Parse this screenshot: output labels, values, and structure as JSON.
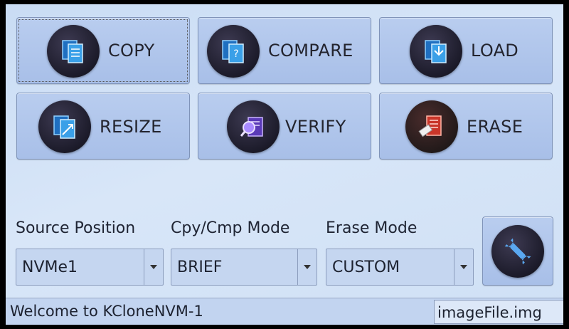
{
  "buttons": {
    "copy": {
      "label": "COPY",
      "icon": "copy-document-icon"
    },
    "compare": {
      "label": "COMPARE",
      "icon": "compare-document-icon"
    },
    "load": {
      "label": "LOAD",
      "icon": "load-document-icon"
    },
    "resize": {
      "label": "RESIZE",
      "icon": "resize-document-icon"
    },
    "verify": {
      "label": "VERIFY",
      "icon": "magnifier-document-icon"
    },
    "erase": {
      "label": "ERASE",
      "icon": "eraser-document-icon"
    }
  },
  "settings": {
    "source_position": {
      "label": "Source Position",
      "value": "NVMe1"
    },
    "cpy_cmp_mode": {
      "label": "Cpy/Cmp Mode",
      "value": "BRIEF"
    },
    "erase_mode": {
      "label": "Erase Mode",
      "value": "CUSTOM"
    }
  },
  "tools_button": {
    "icon": "wrench-icon"
  },
  "status": {
    "message": "Welcome to KCloneNVM-1",
    "file": "imageFile.img"
  },
  "colors": {
    "background": "#cfe0f5",
    "button": "#b0c6ec",
    "icon_circle": "#22212f",
    "copy_icon": "#3aa0e8",
    "verify_icon": "#8a5cf0",
    "erase_icon": "#d8452f"
  }
}
